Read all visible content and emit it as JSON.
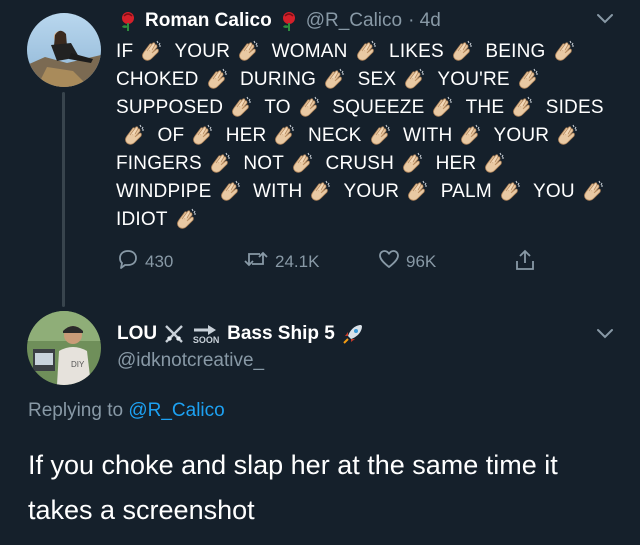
{
  "tweet": {
    "display_name": "Roman Calico",
    "handle": "@R_Calico",
    "time": "· 4d",
    "words": [
      "IF",
      "YOUR",
      "WOMAN",
      "LIKES",
      "BEING",
      "CHOKED",
      "DURING",
      "SEX",
      "YOU'RE",
      "SUPPOSED",
      "TO",
      "SQUEEZE",
      "THE",
      "SIDES",
      "OF",
      "HER",
      "NECK",
      "WITH",
      "YOUR",
      "FINGERS",
      "NOT",
      "CRUSH",
      "HER",
      "WINDPIPE",
      "WITH",
      "YOUR",
      "PALM",
      "YOU",
      "IDIOT"
    ],
    "reply_count": "430",
    "retweet_count": "24.1K",
    "like_count": "96K"
  },
  "reply": {
    "display_name": "LOU",
    "soon_label": "SOON",
    "name_suffix": "Bass Ship 5",
    "handle": "@idknotcreative_",
    "replying_to_label": "Replying to",
    "replying_to_handle": "@R_Calico",
    "text": "If you choke and slap her at the same time it takes a screenshot"
  },
  "icons": {
    "rose": "rose-icon",
    "clap": "clapping-hands-icon",
    "rocket": "rocket-icon",
    "swords": "crossed-swords-icon",
    "soon": "soon-arrow-icon"
  },
  "colors": {
    "background": "#15202b",
    "secondary_text": "#8899a6",
    "link": "#1da1f2",
    "divider": "#38444d"
  }
}
